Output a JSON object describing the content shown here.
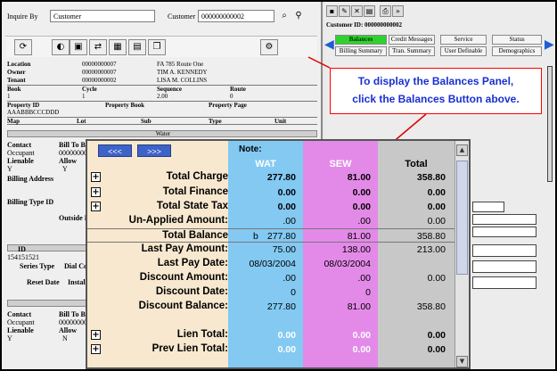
{
  "inquire": {
    "label": "Inquire By",
    "value": "Customer"
  },
  "customer_field": {
    "label": "Customer",
    "value": "000000000002"
  },
  "left_info": {
    "location": {
      "label": "Location",
      "id": "00000000007",
      "addr": "FA 785 Route One"
    },
    "owner": {
      "label": "Owner",
      "id": "00000000007",
      "name": "TIM A. KENNEDY"
    },
    "tenant": {
      "label": "Tenant",
      "id": "00000000002",
      "name": "LISA M. COLLINS"
    },
    "headers1": [
      "Book",
      "Cycle",
      "Sequence",
      "Route"
    ],
    "values1": [
      "1",
      "1",
      "2.00",
      "0"
    ],
    "headers2": [
      "Property ID",
      "Property Book",
      "Property Page"
    ],
    "value2": "AAABBBCCCDDD",
    "headers3": [
      "Map",
      "Lot",
      "Sub",
      "Type",
      "Unit"
    ],
    "water": "Water",
    "side_labels": [
      "Contact",
      "Occupant",
      "Lienable",
      "Y",
      "Billing Address",
      "Billing Type ID",
      "ID",
      "154151521",
      "Series Type",
      "Reset Date",
      "Bill To",
      "Occupant",
      "Lienable",
      "Y"
    ],
    "side_values": [
      "Bill To B",
      "000000000",
      "Allow",
      "Y",
      "Outside In",
      "Dial Co",
      "Install",
      "Bill To B",
      "000000000",
      "Allow",
      "N"
    ]
  },
  "right": {
    "customer_id": "Customer ID: 000000000002",
    "buttons_row1": [
      "Balances",
      "Credit Messages",
      "Service",
      "Status"
    ],
    "buttons_row2": [
      "Billing Summary",
      "Tran. Summary",
      "User Definable",
      "Demographics"
    ]
  },
  "callout": {
    "line1": "To display the Balances Panel,",
    "line2": "click the Balances Button above."
  },
  "balances": {
    "prev_btn": "<<<",
    "next_btn": ">>>",
    "note_label": "Note:",
    "columns": [
      "WAT",
      "SEW",
      "Total"
    ],
    "rows": [
      {
        "label": "Total Charge",
        "expand": true,
        "wat": "277.80",
        "sew": "81.00",
        "total": "358.80",
        "bold": true
      },
      {
        "label": "Total Finance",
        "expand": true,
        "wat": "0.00",
        "sew": "0.00",
        "total": "0.00",
        "bold": true
      },
      {
        "label": "Total State Tax",
        "expand": true,
        "wat": "0.00",
        "sew": "0.00",
        "total": "0.00",
        "bold": true
      },
      {
        "label": "Un-Applied Amount:",
        "expand": false,
        "wat": ".00",
        "sew": ".00",
        "total": "0.00",
        "bold": false
      },
      {
        "label": "Total Balance",
        "expand": false,
        "wat": "277.80",
        "sew": "81.00",
        "total": "358.80",
        "bold": false,
        "marker": "b"
      },
      {
        "label": "Last Pay Amount:",
        "expand": false,
        "wat": "75.00",
        "sew": "138.00",
        "total": "213.00",
        "bold": false
      },
      {
        "label": "Last Pay Date:",
        "expand": false,
        "wat": "08/03/2004",
        "sew": "08/03/2004",
        "total": "",
        "bold": false
      },
      {
        "label": "Discount Amount:",
        "expand": false,
        "wat": ".00",
        "sew": ".00",
        "total": "0.00",
        "bold": false
      },
      {
        "label": "Discount Date:",
        "expand": false,
        "wat": "0",
        "sew": "0",
        "total": "",
        "bold": false
      },
      {
        "label": "Discount Balance:",
        "expand": false,
        "wat": "277.80",
        "sew": "81.00",
        "total": "358.80",
        "bold": false
      },
      {
        "label": "Lien Total:",
        "expand": true,
        "wat": "0.00",
        "sew": "0.00",
        "total": "0.00",
        "bold": true,
        "lite": true
      },
      {
        "label": "Prev Lien Total:",
        "expand": true,
        "wat": "0.00",
        "sew": "0.00",
        "total": "0.00",
        "bold": true,
        "lite": true
      }
    ]
  }
}
